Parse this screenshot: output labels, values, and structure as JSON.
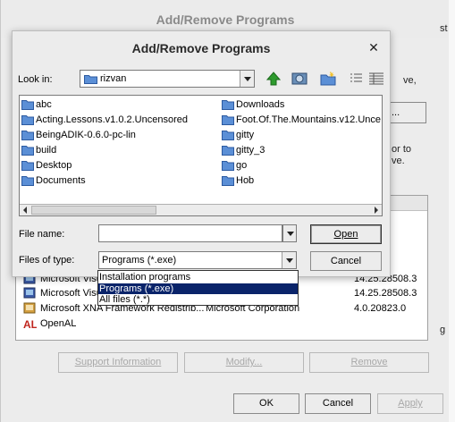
{
  "back_window": {
    "title": "Add/Remove Programs",
    "peek_texts": [
      "st",
      "ve,",
      "...",
      "or to",
      "ve.",
      "g"
    ],
    "list_rows": [
      {
        "name": "Microsoft Visu",
        "publisher": "",
        "version": "14.25.28508.3"
      },
      {
        "name": "Microsoft Visu",
        "publisher": "",
        "version": "14.25.28508.3"
      },
      {
        "name": "Microsoft XNA Framework Redistrib...",
        "publisher": "Microsoft Corporation",
        "version": "4.0.20823.0"
      },
      {
        "name": "OpenAL",
        "publisher": "",
        "version": ""
      }
    ],
    "buttons": {
      "support": "Support Information",
      "modify": "Modify...",
      "remove": "Remove"
    },
    "bottom_buttons": {
      "ok": "OK",
      "cancel": "Cancel",
      "apply": "Apply"
    }
  },
  "dialog": {
    "title": "Add/Remove Programs",
    "look_in_label": "Look in:",
    "look_in_value": "rizvan",
    "files": [
      {
        "name": "abc",
        "column": 0
      },
      {
        "name": "Acting.Lessons.v1.0.2.Uncensored",
        "column": 0
      },
      {
        "name": "BeingADIK-0.6.0-pc-lin",
        "column": 0
      },
      {
        "name": "build",
        "column": 0
      },
      {
        "name": "Desktop",
        "column": 0
      },
      {
        "name": "Documents",
        "column": 0
      },
      {
        "name": "Downloads",
        "column": 1
      },
      {
        "name": "Foot.Of.The.Mountains.v12.Unce",
        "column": 1
      },
      {
        "name": "gitty",
        "column": 1
      },
      {
        "name": "gitty_3",
        "column": 1
      },
      {
        "name": "go",
        "column": 1
      },
      {
        "name": "Hob",
        "column": 1
      }
    ],
    "file_name_label": "File name:",
    "file_name_value": "",
    "files_of_type_label": "Files of type:",
    "files_of_type_value": "Programs (*.exe)",
    "open_button": "Open",
    "cancel_button": "Cancel",
    "type_options": [
      "Installation programs",
      "Programs (*.exe)",
      "All files (*.*)"
    ],
    "selected_type_index": 1
  },
  "colors": {
    "selection": "#0a246a",
    "folder": "#5b8fd6",
    "arrow_green": "#2e9b2e"
  }
}
